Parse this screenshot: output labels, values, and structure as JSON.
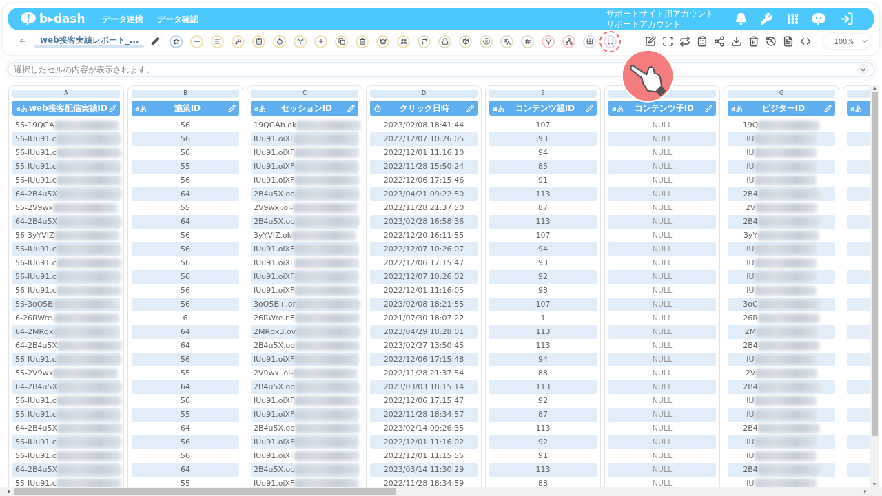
{
  "header": {
    "logo": "b▸dash",
    "nav": [
      "データ連携",
      "データ確認"
    ],
    "account": [
      "サポートサイト用アカウント",
      "サポートアカウント"
    ]
  },
  "report": {
    "title": "web接客実績レポート_..."
  },
  "tools": [
    {
      "color": "#b9d3ec",
      "highlighted": false
    },
    {
      "color": "#f3dfae",
      "highlighted": false
    },
    {
      "color": "#f3dfae",
      "highlighted": false
    },
    {
      "color": "#f3dfae",
      "highlighted": false
    },
    {
      "color": "#f3dfae",
      "highlighted": false
    },
    {
      "color": "#f3dfae",
      "highlighted": false
    },
    {
      "color": "#f3dfae",
      "highlighted": false
    },
    {
      "color": "#f3dfae",
      "highlighted": false
    },
    {
      "color": "#f3dfae",
      "highlighted": false
    },
    {
      "color": "#f3dfae",
      "highlighted": false
    },
    {
      "color": "#f3dfae",
      "highlighted": false
    },
    {
      "color": "#f3dfae",
      "highlighted": false
    },
    {
      "color": "#dbe5c6",
      "highlighted": false
    },
    {
      "color": "#dbe5c6",
      "highlighted": false
    },
    {
      "color": "#dbe5c6",
      "highlighted": false
    },
    {
      "color": "#dbe5c6",
      "highlighted": false
    },
    {
      "color": "#dbe5c6",
      "highlighted": false
    },
    {
      "color": "#dbe5c6",
      "highlighted": false
    },
    {
      "color": "#f6c8c8",
      "highlighted": false
    },
    {
      "color": "#f6c8c8",
      "highlighted": false
    },
    {
      "color": "#e8d6f3",
      "highlighted": false
    },
    {
      "color": "#e8d6f3",
      "highlighted": true
    }
  ],
  "zoom": {
    "value": "100%"
  },
  "cell_viewer": {
    "placeholder": "選択したセルの内容が表示されます。"
  },
  "table": {
    "columns": [
      {
        "letter": "A",
        "title": "web接客配信実績ID",
        "kind": "text",
        "type_label": "aあ",
        "redacted": true
      },
      {
        "letter": "B",
        "title": "施策ID",
        "kind": "text",
        "type_label": "aあ",
        "redacted": false
      },
      {
        "letter": "C",
        "title": "セッションID",
        "kind": "text",
        "type_label": "aあ",
        "redacted": true
      },
      {
        "letter": "D",
        "title": "クリック日時",
        "kind": "datetime",
        "redacted": false
      },
      {
        "letter": "E",
        "title": "コンテンツ親ID",
        "kind": "text",
        "type_label": "aあ",
        "redacted": false
      },
      {
        "title": "コンテンツ子ID",
        "kind": "text",
        "type_label": "aあ",
        "redacted": false
      },
      {
        "letter": "G",
        "title": "ビジターID",
        "kind": "text",
        "type_label": "aあ",
        "redacted": true
      },
      {
        "kind": "text",
        "type_label": "aあ",
        "partial": true
      }
    ],
    "rows": [
      [
        "56-19QGA",
        "56",
        "19QGAb.ok",
        "2023/02/08 18:41:44",
        "107",
        "NULL",
        "19Q"
      ],
      [
        "56-IUu91.c",
        "56",
        "IUu91.oiXF",
        "2022/12/07 10:26:05",
        "93",
        "NULL",
        "IU"
      ],
      [
        "56-IUu91.c",
        "56",
        "IUu91.oiXF",
        "2022/12/01 11:16:10",
        "94",
        "NULL",
        "IU"
      ],
      [
        "55-IUu91.c",
        "55",
        "IUu91.oiXF",
        "2022/11/28 15:50:24",
        "85",
        "NULL",
        "IU"
      ],
      [
        "56-IUu91.c",
        "56",
        "IUu91.oiXF",
        "2022/12/06 17:15:46",
        "91",
        "NULL",
        "IU"
      ],
      [
        "64-2B4u5X",
        "64",
        "2B4u5X.oo",
        "2023/04/21 09:22:50",
        "113",
        "NULL",
        "2B4"
      ],
      [
        "55-2V9wx",
        "55",
        "2V9wxi.oi-",
        "2022/11/28 21:37:50",
        "87",
        "NULL",
        "2V"
      ],
      [
        "64-2B4u5X",
        "64",
        "2B4u5X.oo",
        "2023/02/28 16:58:36",
        "113",
        "NULL",
        "2B4"
      ],
      [
        "56-3yYVIZ",
        "56",
        "3yYVIZ.ok",
        "2022/12/20 16:11:55",
        "107",
        "NULL",
        "3yY"
      ],
      [
        "56-IUu91.c",
        "56",
        "IUu91.oiXF",
        "2022/12/07 10:26:07",
        "94",
        "NULL",
        "IU"
      ],
      [
        "56-IUu91.c",
        "56",
        "IUu91.oiXF",
        "2022/12/06 17:15:47",
        "93",
        "NULL",
        "IU"
      ],
      [
        "56-IUu91.c",
        "56",
        "IUu91.oiXF",
        "2022/12/07 10:26:02",
        "92",
        "NULL",
        "IU"
      ],
      [
        "56-IUu91.c",
        "56",
        "IUu91.oiXF",
        "2022/12/01 11:16:05",
        "93",
        "NULL",
        "IU"
      ],
      [
        "56-3oQ5B",
        "56",
        "3oQ5B+.or",
        "2023/02/08 18:21:55",
        "107",
        "NULL",
        "3oC"
      ],
      [
        "6-26RWre.",
        "6",
        "26RWre.nE",
        "2021/07/30 18:07:22",
        "1",
        "NULL",
        "26R"
      ],
      [
        "64-2MRgx",
        "64",
        "2MRgx3.ov",
        "2023/04/29 18:28:01",
        "113",
        "NULL",
        "2M"
      ],
      [
        "64-2B4u5X",
        "64",
        "2B4u5X.oo",
        "2023/02/27 13:50:45",
        "113",
        "NULL",
        "2B4"
      ],
      [
        "56-IUu91.c",
        "56",
        "IUu91.oiXF",
        "2022/12/06 17:15:48",
        "94",
        "NULL",
        "IU"
      ],
      [
        "55-2V9wx",
        "55",
        "2V9wxi.oi-",
        "2022/11/28 21:37:54",
        "88",
        "NULL",
        "2V"
      ],
      [
        "64-2B4u5X",
        "64",
        "2B4u5X.oo",
        "2023/03/03 18:15:14",
        "113",
        "NULL",
        "2B4"
      ],
      [
        "56-IUu91.c",
        "56",
        "IUu91.oiXF",
        "2022/12/06 17:15:47",
        "92",
        "NULL",
        "IU"
      ],
      [
        "55-IUu91.c",
        "55",
        "IUu91.oiXF",
        "2022/11/28 18:34:57",
        "87",
        "NULL",
        "IU"
      ],
      [
        "64-2B4u5X",
        "64",
        "2B4u5X.oo",
        "2023/02/14 09:26:35",
        "113",
        "NULL",
        "2B4"
      ],
      [
        "56-IUu91.c",
        "56",
        "IUu91.oiXF",
        "2022/12/01 11:16:02",
        "92",
        "NULL",
        "IU"
      ],
      [
        "56-IUu91.c",
        "56",
        "IUu91.oiXF",
        "2022/12/01 11:15:55",
        "91",
        "NULL",
        "IU"
      ],
      [
        "64-2B4u5X",
        "64",
        "2B4u5X.oo",
        "2023/03/14 11:30:29",
        "113",
        "NULL",
        "2B4"
      ],
      [
        "55-IUu91.c",
        "55",
        "IUu91.oiXF",
        "2022/11/28 18:34:59",
        "88",
        "NULL",
        "IU"
      ]
    ]
  }
}
